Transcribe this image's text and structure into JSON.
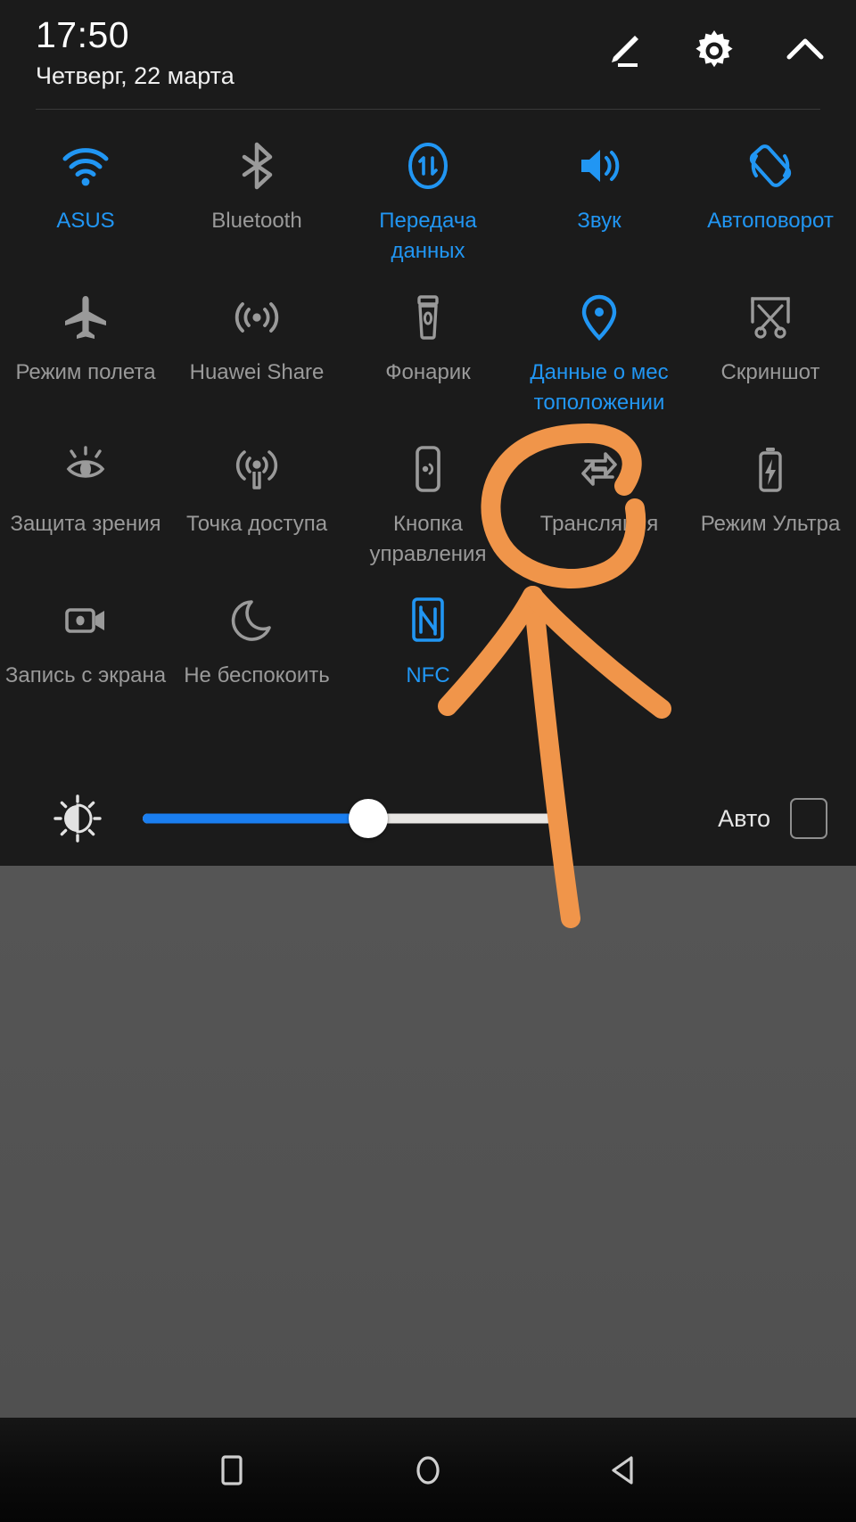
{
  "statusbar": {
    "time": "17:50",
    "date": "Четверг, 22 марта"
  },
  "header": {
    "edit_icon": "pencil-edit-icon",
    "settings_icon": "gear-icon",
    "collapse_icon": "chevron-up-icon"
  },
  "colors": {
    "accent_blue": "#2196f3",
    "inactive_gray": "#9a9a9a",
    "panel_bg": "#1b1b1b",
    "wallpaper_gray": "#575757",
    "annotation_orange": "#f0954a",
    "slider_fill": "#1a7ef0"
  },
  "tiles": [
    [
      {
        "label": "ASUS",
        "icon": "wifi-icon",
        "state": "on"
      },
      {
        "label": "Bluetooth",
        "icon": "bluetooth-icon",
        "state": "off"
      },
      {
        "label": "Передача данных",
        "icon": "mobile-data-icon",
        "state": "on"
      },
      {
        "label": "Звук",
        "icon": "sound-speaker-icon",
        "state": "on"
      },
      {
        "label": "Автоповорот",
        "icon": "auto-rotate-icon",
        "state": "on"
      }
    ],
    [
      {
        "label": "Режим полета",
        "icon": "airplane-icon",
        "state": "off"
      },
      {
        "label": "Huawei Share",
        "icon": "huawei-share-icon",
        "state": "off"
      },
      {
        "label": "Фонарик",
        "icon": "flashlight-icon",
        "state": "off"
      },
      {
        "label": "Данные о мес тоположении",
        "icon": "location-pin-icon",
        "state": "on"
      },
      {
        "label": "Скриншот",
        "icon": "screenshot-scissors-icon",
        "state": "off"
      }
    ],
    [
      {
        "label": "Защита зрения",
        "icon": "eye-protection-icon",
        "state": "off"
      },
      {
        "label": "Точка доступа",
        "icon": "hotspot-icon",
        "state": "off"
      },
      {
        "label": "Кнопка управления",
        "icon": "navigation-dock-icon",
        "state": "off"
      },
      {
        "label": "Трансляция",
        "icon": "cast-screen-icon",
        "state": "off"
      },
      {
        "label": "Режим Ультра",
        "icon": "battery-ultra-icon",
        "state": "off"
      }
    ],
    [
      {
        "label": "Запись с экрана",
        "icon": "screen-record-icon",
        "state": "off"
      },
      {
        "label": "Не беспокоить",
        "icon": "moon-dnd-icon",
        "state": "off"
      },
      {
        "label": "NFC",
        "icon": "nfc-icon",
        "state": "on"
      },
      {
        "label": "",
        "icon": "",
        "state": "empty"
      },
      {
        "label": "",
        "icon": "",
        "state": "empty"
      }
    ]
  ],
  "brightness": {
    "icon": "brightness-sun-icon",
    "value_percent": 55,
    "auto_label": "Авто",
    "auto_checked": false
  },
  "annotation": {
    "shape": "hand-drawn-circle-and-arrow",
    "target_tile": "Трансляция",
    "color": "#f0954a"
  },
  "navbar": {
    "recents_icon": "recents-square-icon",
    "home_icon": "home-circle-icon",
    "back_icon": "back-triangle-icon"
  }
}
